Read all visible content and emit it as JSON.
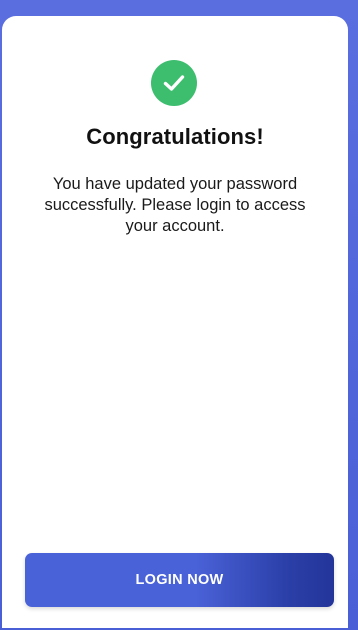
{
  "dialog": {
    "title": "Congratulations!",
    "message": "You have updated your password successfully. Please login to access your account.",
    "icon": "check-circle-icon",
    "button_label": "LOGIN NOW"
  },
  "colors": {
    "background": "#4a5ed6",
    "success": "#3dbd6e",
    "button": "#4a62d8",
    "button_dark": "#23359a"
  }
}
